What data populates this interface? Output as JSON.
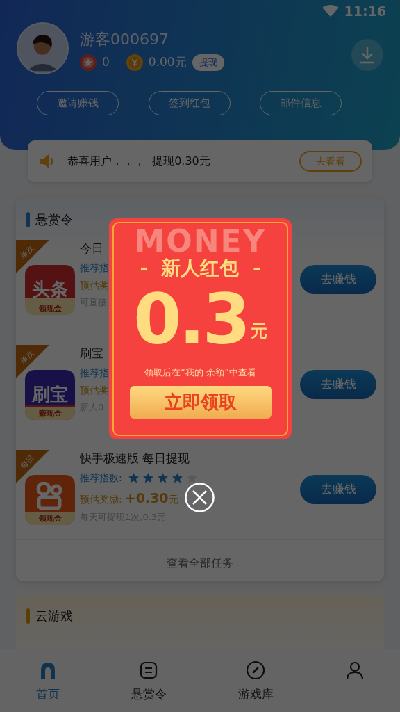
{
  "status_bar": {
    "time": "11:16"
  },
  "profile": {
    "name": "游客000697",
    "stars": "0",
    "balance": "0.00元",
    "withdraw": "提现"
  },
  "actions": [
    "邀请赚钱",
    "签到红包",
    "邮件信息"
  ],
  "notice": {
    "text": "恭喜用户，，，  提现0.30元",
    "button": "去看看"
  },
  "bounty": {
    "title": "悬赏令",
    "tasks": [
      {
        "badge": "单次",
        "logo_text": "头条",
        "logo_caption": "领现金",
        "title": "今日",
        "rating_label": "推荐指",
        "reward_label": "预估奖",
        "note": "可直接",
        "button": "去赚钱"
      },
      {
        "badge": "单次",
        "logo_text": "刷宝",
        "logo_caption": "赚现金",
        "title": "刷宝",
        "rating_label": "推荐指",
        "reward_label": "预估奖",
        "note": "新人0",
        "button": "去赚钱"
      },
      {
        "badge": "每日",
        "logo_caption": "领现金",
        "title": "快手极速版 每日提现",
        "rating_label": "推荐指数:",
        "stars": 4,
        "reward_label": "预估奖励:",
        "reward": "**+0.30**元",
        "note": "每天可提现1次,0.3元",
        "button": "去赚钱"
      }
    ],
    "footer_link": "查看全部任务"
  },
  "cloud_games": {
    "title": "云游戏"
  },
  "tabbar": [
    {
      "label": "首页",
      "selected": true
    },
    {
      "label": "悬赏令",
      "selected": false
    },
    {
      "label": "游戏库",
      "selected": false
    },
    {
      "selected": false
    }
  ],
  "modal": {
    "watermark": "MONEY",
    "title": "-  新人红包  -",
    "amount": "0.3",
    "unit": "元",
    "hint": "领取后在“我的-余额”中查看",
    "button": "立即领取"
  }
}
